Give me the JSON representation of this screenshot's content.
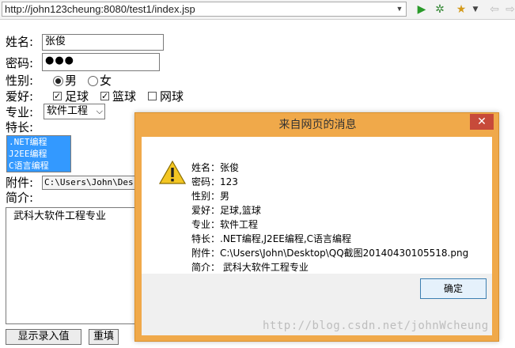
{
  "browser": {
    "url": "http://john123cheung:8080/test1/index.jsp"
  },
  "form": {
    "name_label": "姓名:",
    "name_value": "张俊",
    "password_label": "密码:",
    "password_value": "●●●",
    "gender_label": "性别:",
    "gender_options": [
      "男",
      "女"
    ],
    "gender_selected": "男",
    "hobby_label": "爱好:",
    "hobby_options": [
      {
        "label": "足球",
        "checked": true
      },
      {
        "label": "篮球",
        "checked": true
      },
      {
        "label": "网球",
        "checked": false
      }
    ],
    "major_label": "专业:",
    "major_value": "软件工程",
    "specialty_label": "特长:",
    "specialty_items": [
      ".NET编程",
      "J2EE编程",
      "C语言编程"
    ],
    "attachment_label": "附件:",
    "attachment_value": "C:\\Users\\John\\Des",
    "intro_label": "简介:",
    "intro_value": "武科大软件工程专业",
    "submit_label": "显示录入值",
    "reset_label": "重填"
  },
  "dialog": {
    "title": "来自网页的消息",
    "close_glyph": "✕",
    "lines": [
      "姓名：张俊",
      "密码：123",
      "性别：男",
      "爱好：足球,篮球",
      "专业：软件工程",
      "特长：.NET编程,J2EE编程,C语言编程",
      "附件：C:\\Users\\John\\Desktop\\QQ截图20140430105518.png",
      "简介： 武科大软件工程专业"
    ],
    "ok_label": "确定"
  },
  "watermark": "http://blog.csdn.net/johnWcheung"
}
